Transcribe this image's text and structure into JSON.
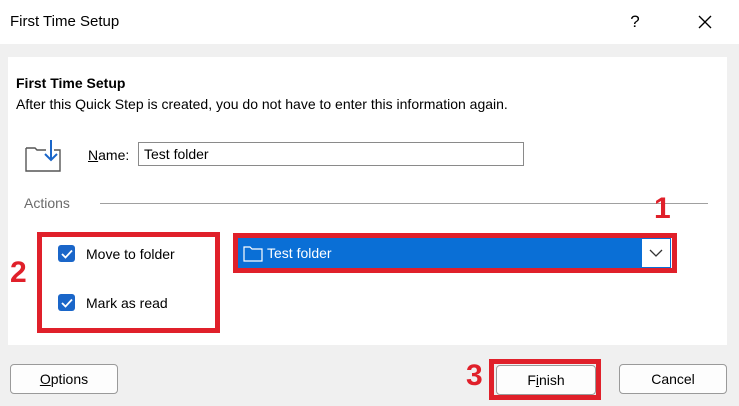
{
  "window": {
    "title": "First Time Setup",
    "help_label": "?"
  },
  "content": {
    "heading": "First Time Setup",
    "description": "After this Quick Step is created, you do not have to enter this information again."
  },
  "name": {
    "label_accel": "N",
    "label_rest": "ame:",
    "value": "Test folder"
  },
  "actions": {
    "label": "Actions",
    "items": [
      {
        "label": "Move to folder",
        "checked": true
      },
      {
        "label": "Mark as read",
        "checked": true
      }
    ],
    "folder_select": {
      "value": "Test folder"
    }
  },
  "annotations": {
    "marker_1": "1",
    "marker_2": "2",
    "marker_3": "3",
    "color": "#e0202a"
  },
  "buttons": {
    "options": {
      "accel": "O",
      "rest": "ptions"
    },
    "finish": {
      "pre": "F",
      "accel": "i",
      "rest": "nish"
    },
    "cancel": "Cancel"
  },
  "colors": {
    "accent": "#1a66c9",
    "select_bg": "#0a6fd6"
  }
}
